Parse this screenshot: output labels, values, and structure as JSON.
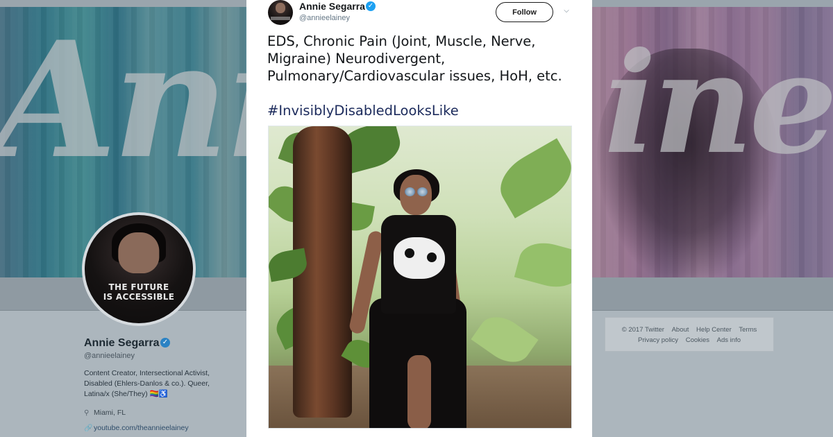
{
  "profile": {
    "name": "Annie Segarra",
    "handle": "@annieelainey",
    "bio": "Content Creator, Intersectional Activist, Disabled (Ehlers-Danlos & co.). Queer, Latina/x (She/They) 🏳️‍🌈♿",
    "location": "Miami, FL",
    "link": "youtube.com/theannieelainey",
    "avatar_shirt_line1": "THE FUTURE",
    "avatar_shirt_line2": "IS ACCESSIBLE",
    "banner_script_left": "Ann",
    "banner_script_right": "ine"
  },
  "footer": {
    "copyright": "© 2017 Twitter",
    "links_row1": [
      "About",
      "Help Center",
      "Terms"
    ],
    "links_row2": [
      "Privacy policy",
      "Cookies",
      "Ads info"
    ]
  },
  "tweet": {
    "author_name": "Annie Segarra",
    "author_handle": "@annieelainey",
    "follow_label": "Follow",
    "text": "EDS, Chronic Pain (Joint, Muscle, Nerve, Migraine) Neurodivergent, Pulmonary/Cardiovascular issues, HoH, etc.",
    "hashtag": "#InvisiblyDisabledLooksLike"
  },
  "icons": {
    "verified": "verified-badge-icon",
    "caret": "chevron-down-icon",
    "location": "location-pin-icon",
    "link": "link-icon"
  },
  "colors": {
    "verified_blue": "#1da1f2",
    "hashtag": "#1c2b5c"
  }
}
